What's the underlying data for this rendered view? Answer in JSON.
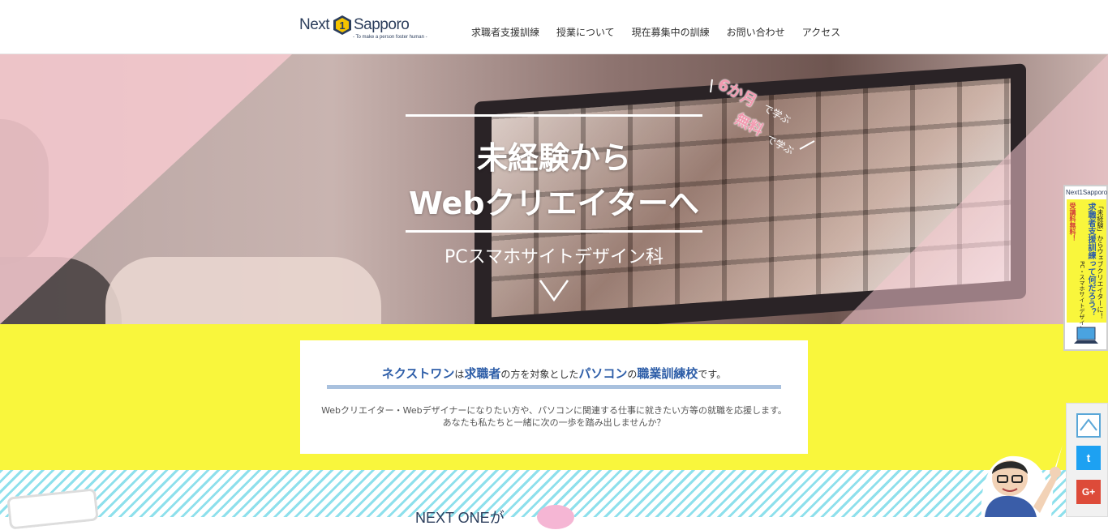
{
  "header": {
    "logo": {
      "left": "Next",
      "right": "Sapporo",
      "badge_number": "1",
      "tagline": "- To make a person foster human -"
    },
    "nav": [
      "求職者支援訓練",
      "授業について",
      "現在募集中の訓練",
      "お問い合わせ",
      "アクセス"
    ]
  },
  "hero": {
    "title_line1": "未経験から",
    "title_line2": "Webクリエイターへ",
    "subtitle": "PCスマホサイトデザイン科",
    "badge": {
      "months": "6か月",
      "study1": "で学ぶ",
      "free": "無料",
      "study2": "で学ぶ"
    }
  },
  "intro": {
    "heading_parts": [
      "ネクストワン",
      "は",
      "求職者",
      "の方を対象とした",
      "パソコン",
      "の",
      "職業訓練校",
      "です。"
    ],
    "body_line1": "Webクリエイター・Webデザイナーになりたい方や、パソコンに関連する仕事に就きたい方等の就職を応援します。",
    "body_line2": "あなたも私たちと一緒に次の一歩を踏み出しませんか？"
  },
  "stripes": {
    "title": "NEXT ONEが"
  },
  "side_banner": {
    "logo": "Next1Sapporo",
    "col1": "「未経験」からウェブクリエイターに！",
    "col2": "求職者支援訓練って何だろう？",
    "col3": "受講料無料！",
    "col4": "PC・スマホサイトデザイン科"
  },
  "social": {
    "top": "top-arrow-icon",
    "twitter": "twitter-icon",
    "google": "google-plus-icon",
    "twitter_label": "t",
    "google_label": "G+"
  },
  "colors": {
    "yellow": "#f9f63c",
    "pink": "#f29ab0",
    "blue": "#2e5ea8",
    "twitter": "#1da1f2",
    "google": "#dd4b39"
  }
}
